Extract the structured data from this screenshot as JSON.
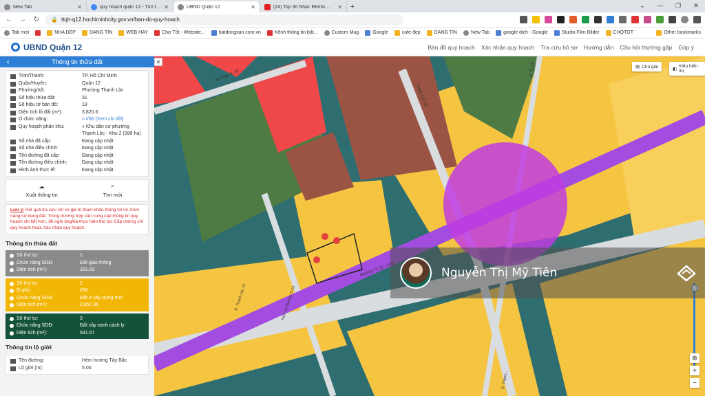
{
  "browser": {
    "tabs": [
      {
        "label": "New Tab",
        "icon": "chrome-icon"
      },
      {
        "label": "quy hoạch quận 12 - Tìm trên Go",
        "icon": "google-icon"
      },
      {
        "label": "UBND Quận 12",
        "icon": "site-icon",
        "active": true
      },
      {
        "label": "(24) Top 30 Nhạc Remix Nghe",
        "icon": "youtube-icon"
      }
    ],
    "address": "ttqh-q12.hochiminhcity.gov.vn/ban-do-quy-hoach",
    "bookmarks": [
      "Tab mới",
      "NHA DEP",
      "DANG TIN",
      "WEB HAY",
      "Chợ Tốt - Website...",
      "batdongsan.com.vn",
      "Kênh thông tin bất...",
      "Custom Mug",
      "Google",
      "cafe đẹp",
      "DANG TIN",
      "New Tab",
      "google dịch - Google",
      "Studio Film Bilder",
      "CHOTOT"
    ],
    "other_bookmarks": "Other bookmarks"
  },
  "site": {
    "logo_text": "UBND Quận 12",
    "nav": [
      "Bản đồ quy hoạch",
      "Xác nhận quy hoạch",
      "Tra cứu hồ sơ",
      "Hướng dẫn",
      "Câu hỏi thường gặp",
      "Góp ý"
    ]
  },
  "panel": {
    "title": "Thông tin thửa đất",
    "info": [
      {
        "label": "Tỉnh/Thành:",
        "value": "TP. Hồ Chí Minh"
      },
      {
        "label": "Quận/Huyện:",
        "value": "Quận 12"
      },
      {
        "label": "Phường/Xã:",
        "value": "Phường Thạnh Lộc"
      },
      {
        "label": "Số hiệu thửa đất:",
        "value": "31"
      },
      {
        "label": "Số hiệu tờ bản đồ:",
        "value": "19"
      },
      {
        "label": "Diện tích lô đất (m²):",
        "value": "3,820.6"
      },
      {
        "label": "Ô chức năng:",
        "value": "» I/56 (Xem chi tiết)",
        "link": true
      },
      {
        "label": "Quy hoạch phân khu:",
        "value": "» Khu dân cư phường Thạnh Lộc - Khu 2 (399 ha)"
      },
      {
        "label": "Số nhà đã cấp:",
        "value": "Đang cập nhật"
      },
      {
        "label": "Số nhà điều chỉnh:",
        "value": "Đang cập nhật"
      },
      {
        "label": "Tên đường đã cấp:",
        "value": "Đang cập nhật"
      },
      {
        "label": "Tên đường điều chỉnh:",
        "value": "Đang cập nhật"
      },
      {
        "label": "Hình ảnh thực tế:",
        "value": "Đang cập nhật"
      }
    ],
    "actions": [
      {
        "label": "Xuất thông tin",
        "icon": "cloud-download-icon"
      },
      {
        "label": "Tìm mới",
        "icon": "search-icon"
      }
    ],
    "note_title": "Lưu ý:",
    "note": " Kết quả tra cứu chỉ có giá trị tham khảo thông tin về chức năng sử dụng đất. Trong trường hợp cần cung cấp thông tin quy hoạch chi tiết hơn, đề nghị ông/bà thực hiện thủ tục Cấp chứng chỉ quy hoạch hoặc Xác nhận quy hoạch.",
    "parcel_section": "Thông tin thửa đất",
    "parcels": [
      {
        "color": "grey",
        "rows": [
          {
            "label": "Số thứ tự:",
            "value": "1"
          },
          {
            "label": "Chức năng SDĐ:",
            "value": "Đất giao thông"
          },
          {
            "label": "Diện tích (m²):",
            "value": "331.63"
          }
        ]
      },
      {
        "color": "yellow",
        "rows": [
          {
            "label": "Số thứ tự:",
            "value": "2"
          },
          {
            "label": "Ô phố:",
            "value": "I/56"
          },
          {
            "label": "Chức năng SDĐ:",
            "value": "Đất ở xây dựng mới"
          },
          {
            "label": "Diện tích (m²):",
            "value": "2,957.36"
          }
        ]
      },
      {
        "color": "green",
        "rows": [
          {
            "label": "Số thứ tự:",
            "value": "3"
          },
          {
            "label": "Chức năng SDĐ:",
            "value": "Đất cây xanh cách ly"
          },
          {
            "label": "Diện tích (m²):",
            "value": "531.57"
          }
        ]
      }
    ],
    "border_section": "Thông tin lộ giới",
    "border": [
      {
        "label": "Tên đường:",
        "value": "Hẻm hướng Tây Bắc"
      },
      {
        "label": "Lộ giới (m):",
        "value": "5.00"
      }
    ]
  },
  "map": {
    "btn_legend": "Chú giải",
    "btn_display": "Kiểu hiển thị",
    "road_labels": [
      "Đường TL 29",
      "Thạnh Lộc 30",
      "Đường TL 12 - KP1",
      "Đ. Thạnh Lộc 13",
      "Hẻm 40 Đường TL13",
      "Đ. TL 13",
      "Đ. Thạnh..."
    ],
    "overlay_name": "Nguyễn Thị Mỹ Tiên",
    "colors": {
      "green": "#4e7a44",
      "red": "#f04848",
      "brown": "#9b5444",
      "yellow": "#f5c542",
      "purple": "#a24de0",
      "magenta": "#c03ce0",
      "road": "#d9dde0",
      "water": "#2f6e70"
    }
  }
}
